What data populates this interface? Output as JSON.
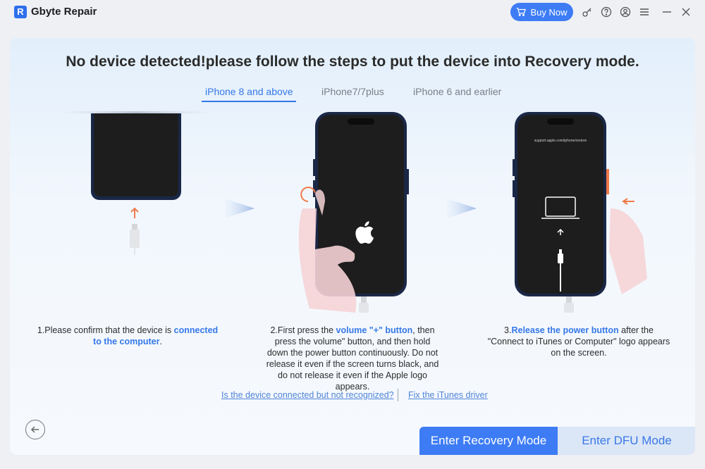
{
  "app": {
    "title": "Gbyte Repair",
    "logo_letter": "R"
  },
  "titlebar": {
    "buy_label": "Buy Now",
    "icons": [
      "cart-icon",
      "key-icon",
      "help-icon",
      "account-icon",
      "menu-icon",
      "minimize-icon",
      "close-icon"
    ]
  },
  "main": {
    "heading": "No device detected!please follow the steps to put the device into Recovery mode.",
    "tabs": [
      {
        "label": "iPhone 8 and above",
        "active": true
      },
      {
        "label": "iPhone7/7plus",
        "active": false
      },
      {
        "label": "iPhone 6 and earlier",
        "active": false
      }
    ],
    "phone3_url": "support.apple.com/iphone/restore",
    "steps": [
      {
        "pre": "1.Please confirm that the device is ",
        "hl": "connected to the computer",
        "post": "."
      },
      {
        "pre": "2.First press the ",
        "hl": "volume \"+\" button",
        "post": ", then press the volume\" button, and then hold down the power button continuously. Do not release it even if the screen turns black, and do not release it even if the Apple logo appears."
      },
      {
        "pre": "3.",
        "hl": "Release the power button",
        "post": " after the \"Connect to iTunes or Computer\" logo appears on the screen."
      }
    ],
    "links": {
      "not_recognized": "Is the device connected but not recognized?",
      "fix_driver": "Fix the iTunes driver"
    }
  },
  "footer": {
    "enter_recovery": "Enter Recovery Mode",
    "enter_dfu": "Enter DFU Mode"
  },
  "colors": {
    "accent": "#3d7cf5",
    "link": "#4e84d8",
    "arrow_orange": "#f07a4a"
  }
}
